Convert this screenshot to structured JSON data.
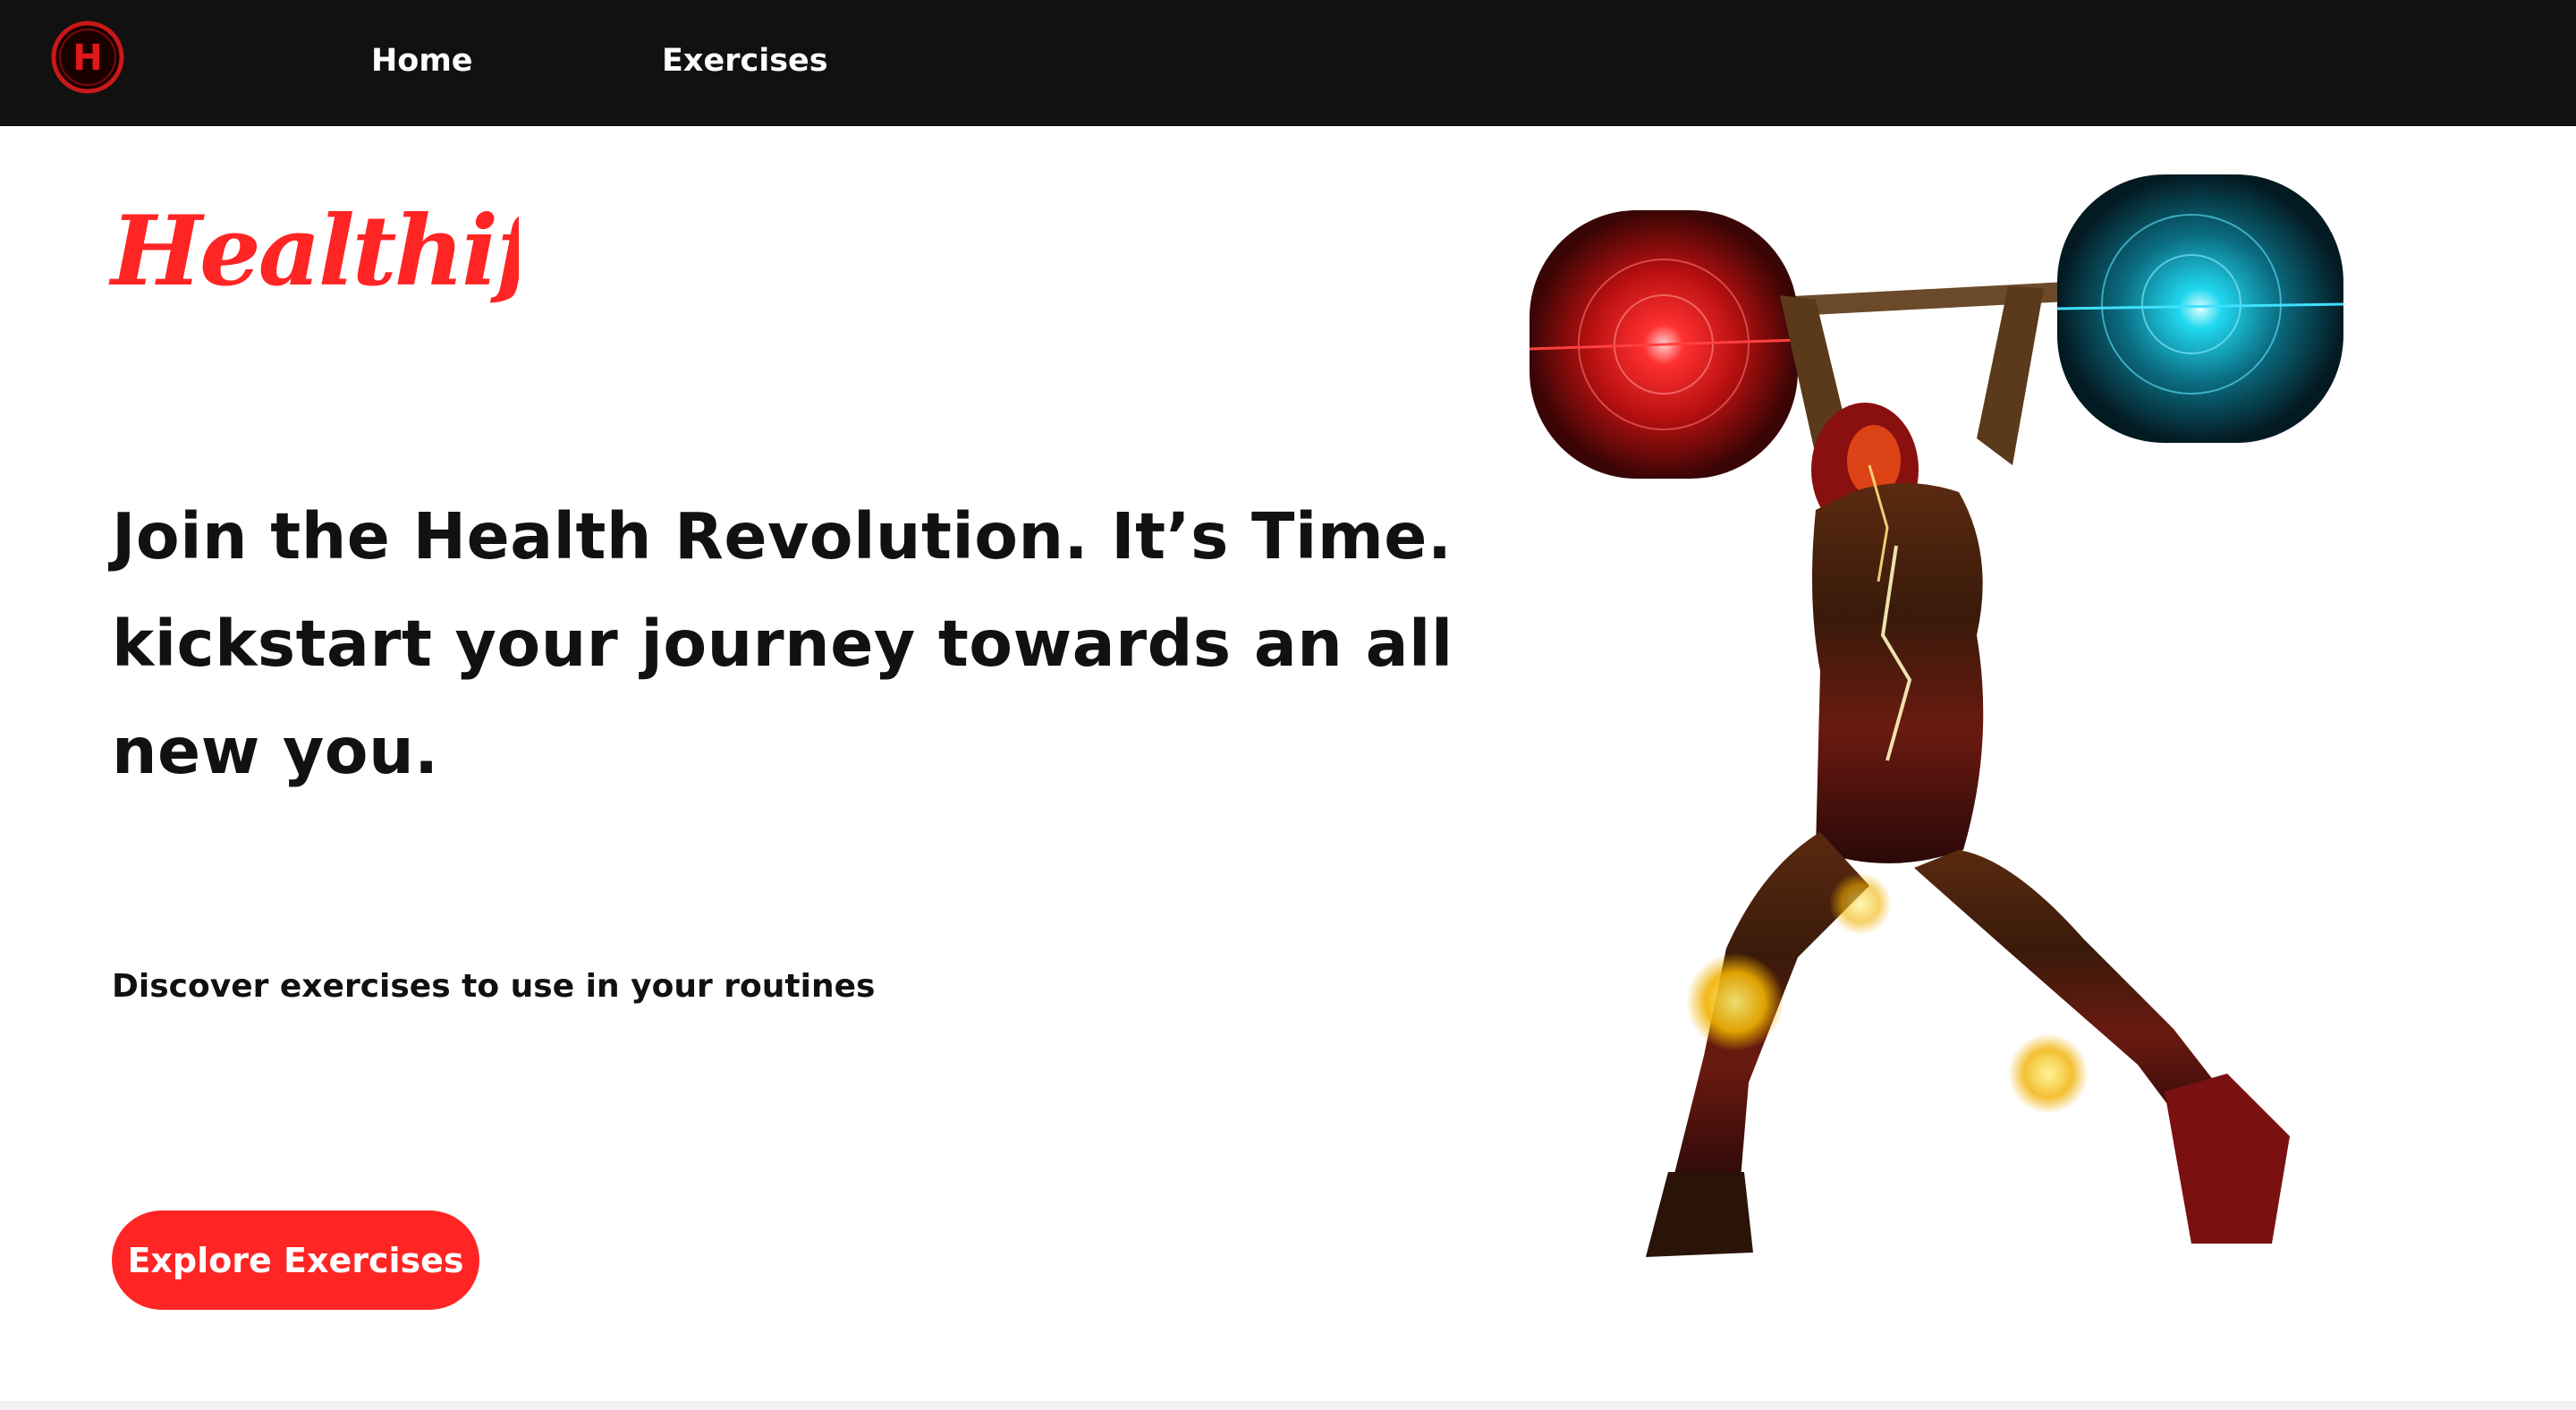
{
  "nav": {
    "logo_letter": "H",
    "links": [
      {
        "label": "Home"
      },
      {
        "label": "Exercises"
      }
    ]
  },
  "brand": {
    "name": "Healthify",
    "color": "#ff2525"
  },
  "hero": {
    "headline": "Join the Health Revolution. It’s Time. kickstart your journey towards an all new you.",
    "subtitle": "Discover exercises to use in your routines",
    "cta_label": "Explore Exercises"
  },
  "colors": {
    "navbar_bg": "#111111",
    "accent": "#ff2525",
    "text": "#111111",
    "plate_left": "#e01818",
    "plate_right": "#1ec8e6"
  },
  "icons": {
    "logo": "circled-letter-h-icon",
    "illustration": "weightlifter-barbell-illustration"
  }
}
